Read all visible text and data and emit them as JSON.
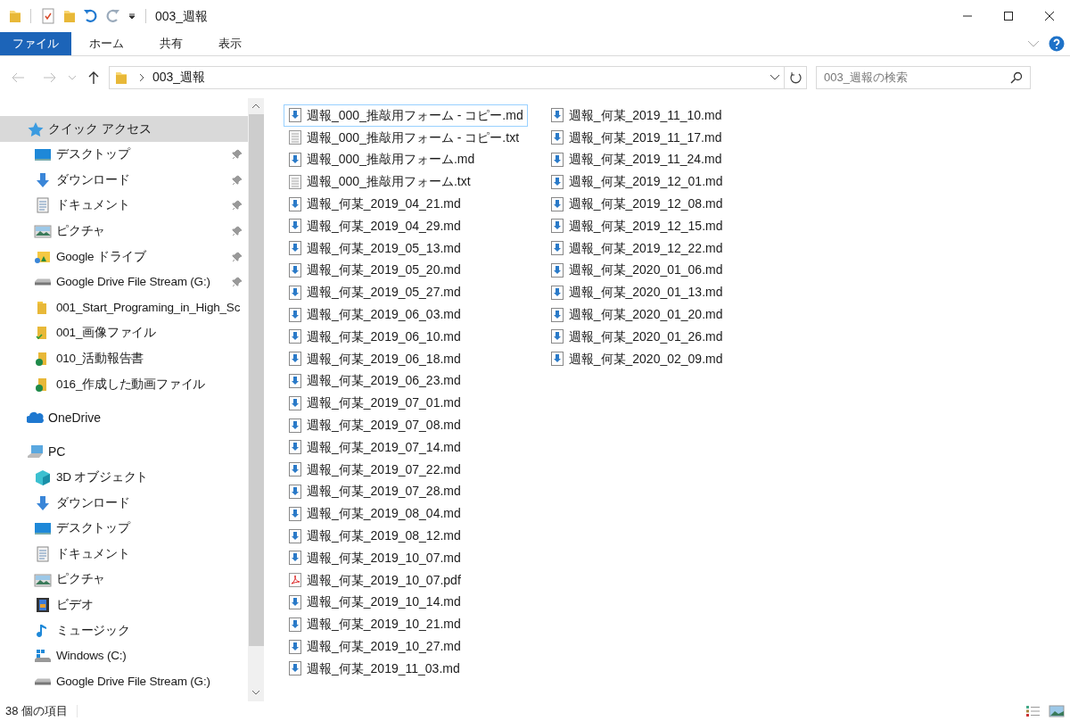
{
  "window": {
    "title": "003_週報"
  },
  "ribbon_tabs": [
    {
      "label": "ファイル",
      "selected": true
    },
    {
      "label": "ホーム",
      "selected": false
    },
    {
      "label": "共有",
      "selected": false
    },
    {
      "label": "表示",
      "selected": false
    }
  ],
  "address": {
    "crumb": "003_週報"
  },
  "search": {
    "placeholder": "003_週報の検索"
  },
  "sidebar": [
    {
      "label": "クイック アクセス",
      "kind": "star",
      "selected": true,
      "children": [
        {
          "label": "デスクトップ",
          "kind": "desktop",
          "pinned": true
        },
        {
          "label": "ダウンロード",
          "kind": "download",
          "pinned": true
        },
        {
          "label": "ドキュメント",
          "kind": "document",
          "pinned": true
        },
        {
          "label": "ピクチャ",
          "kind": "pictures",
          "pinned": true
        },
        {
          "label": "Google ドライブ",
          "kind": "gdrive",
          "pinned": true
        },
        {
          "label": "Google Drive File Stream (G:)",
          "kind": "drive",
          "pinned": true
        },
        {
          "label": "001_Start_Programing_in_High_Sc",
          "kind": "folder",
          "pinned": false
        },
        {
          "label": "001_画像ファイル",
          "kind": "folder-check",
          "pinned": false
        },
        {
          "label": "010_活動報告書",
          "kind": "folder-synced",
          "pinned": false
        },
        {
          "label": "016_作成した動画ファイル",
          "kind": "folder-synced",
          "pinned": false
        }
      ]
    },
    {
      "label": "OneDrive",
      "kind": "cloud",
      "selected": false
    },
    {
      "label": "PC",
      "kind": "pc",
      "selected": false,
      "children": [
        {
          "label": "3D オブジェクト",
          "kind": "cube",
          "pinned": false
        },
        {
          "label": "ダウンロード",
          "kind": "download",
          "pinned": false
        },
        {
          "label": "デスクトップ",
          "kind": "desktop",
          "pinned": false
        },
        {
          "label": "ドキュメント",
          "kind": "document",
          "pinned": false
        },
        {
          "label": "ピクチャ",
          "kind": "pictures",
          "pinned": false
        },
        {
          "label": "ビデオ",
          "kind": "video",
          "pinned": false
        },
        {
          "label": "ミュージック",
          "kind": "music",
          "pinned": false
        },
        {
          "label": "Windows (C:)",
          "kind": "windows-drive",
          "pinned": false
        },
        {
          "label": "Google Drive File Stream (G:)",
          "kind": "drive",
          "pinned": false
        }
      ]
    }
  ],
  "files": [
    {
      "name": "週報_000_推敲用フォーム - コピー.md",
      "kind": "md",
      "selected": true
    },
    {
      "name": "週報_000_推敲用フォーム - コピー.txt",
      "kind": "txt",
      "selected": false
    },
    {
      "name": "週報_000_推敲用フォーム.md",
      "kind": "md",
      "selected": false
    },
    {
      "name": "週報_000_推敲用フォーム.txt",
      "kind": "txt",
      "selected": false
    },
    {
      "name": "週報_何某_2019_04_21.md",
      "kind": "md",
      "selected": false
    },
    {
      "name": "週報_何某_2019_04_29.md",
      "kind": "md",
      "selected": false
    },
    {
      "name": "週報_何某_2019_05_13.md",
      "kind": "md",
      "selected": false
    },
    {
      "name": "週報_何某_2019_05_20.md",
      "kind": "md",
      "selected": false
    },
    {
      "name": "週報_何某_2019_05_27.md",
      "kind": "md",
      "selected": false
    },
    {
      "name": "週報_何某_2019_06_03.md",
      "kind": "md",
      "selected": false
    },
    {
      "name": "週報_何某_2019_06_10.md",
      "kind": "md",
      "selected": false
    },
    {
      "name": "週報_何某_2019_06_18.md",
      "kind": "md",
      "selected": false
    },
    {
      "name": "週報_何某_2019_06_23.md",
      "kind": "md",
      "selected": false
    },
    {
      "name": "週報_何某_2019_07_01.md",
      "kind": "md",
      "selected": false
    },
    {
      "name": "週報_何某_2019_07_08.md",
      "kind": "md",
      "selected": false
    },
    {
      "name": "週報_何某_2019_07_14.md",
      "kind": "md",
      "selected": false
    },
    {
      "name": "週報_何某_2019_07_22.md",
      "kind": "md",
      "selected": false
    },
    {
      "name": "週報_何某_2019_07_28.md",
      "kind": "md",
      "selected": false
    },
    {
      "name": "週報_何某_2019_08_04.md",
      "kind": "md",
      "selected": false
    },
    {
      "name": "週報_何某_2019_08_12.md",
      "kind": "md",
      "selected": false
    },
    {
      "name": "週報_何某_2019_10_07.md",
      "kind": "md",
      "selected": false
    },
    {
      "name": "週報_何某_2019_10_07.pdf",
      "kind": "pdf",
      "selected": false
    },
    {
      "name": "週報_何某_2019_10_14.md",
      "kind": "md",
      "selected": false
    },
    {
      "name": "週報_何某_2019_10_21.md",
      "kind": "md",
      "selected": false
    },
    {
      "name": "週報_何某_2019_10_27.md",
      "kind": "md",
      "selected": false
    },
    {
      "name": "週報_何某_2019_11_03.md",
      "kind": "md",
      "selected": false
    },
    {
      "name": "週報_何某_2019_11_10.md",
      "kind": "md",
      "selected": false
    },
    {
      "name": "週報_何某_2019_11_17.md",
      "kind": "md",
      "selected": false
    },
    {
      "name": "週報_何某_2019_11_24.md",
      "kind": "md",
      "selected": false
    },
    {
      "name": "週報_何某_2019_12_01.md",
      "kind": "md",
      "selected": false
    },
    {
      "name": "週報_何某_2019_12_08.md",
      "kind": "md",
      "selected": false
    },
    {
      "name": "週報_何某_2019_12_15.md",
      "kind": "md",
      "selected": false
    },
    {
      "name": "週報_何某_2019_12_22.md",
      "kind": "md",
      "selected": false
    },
    {
      "name": "週報_何某_2020_01_06.md",
      "kind": "md",
      "selected": false
    },
    {
      "name": "週報_何某_2020_01_13.md",
      "kind": "md",
      "selected": false
    },
    {
      "name": "週報_何某_2020_01_20.md",
      "kind": "md",
      "selected": false
    },
    {
      "name": "週報_何某_2020_01_26.md",
      "kind": "md",
      "selected": false
    },
    {
      "name": "週報_何某_2020_02_09.md",
      "kind": "md",
      "selected": false
    }
  ],
  "status_bar": {
    "count": "38 個の項目"
  }
}
